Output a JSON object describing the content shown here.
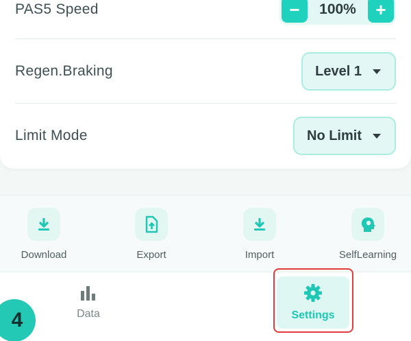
{
  "settings": {
    "pas5": {
      "label": "PAS5 Speed",
      "value": "100%",
      "minus": "−",
      "plus": "+"
    },
    "regen": {
      "label": "Regen.Braking",
      "value": "Level 1"
    },
    "limit": {
      "label": "Limit Mode",
      "value": "No Limit"
    }
  },
  "toolbar": {
    "items": [
      {
        "label": "Download",
        "icon": "download-icon"
      },
      {
        "label": "Export",
        "icon": "export-icon"
      },
      {
        "label": "Import",
        "icon": "import-icon"
      },
      {
        "label": "SelfLearning",
        "icon": "self-learning-icon"
      }
    ]
  },
  "tabs": {
    "data": {
      "label": "Data",
      "icon": "bar-chart-icon"
    },
    "settings": {
      "label": "Settings",
      "icon": "gear-icon",
      "active": true
    }
  },
  "step_badge": "4",
  "colors": {
    "accent": "#1fd2be",
    "accent_light": "#e3f7f4",
    "highlight": "#e23b3b"
  }
}
